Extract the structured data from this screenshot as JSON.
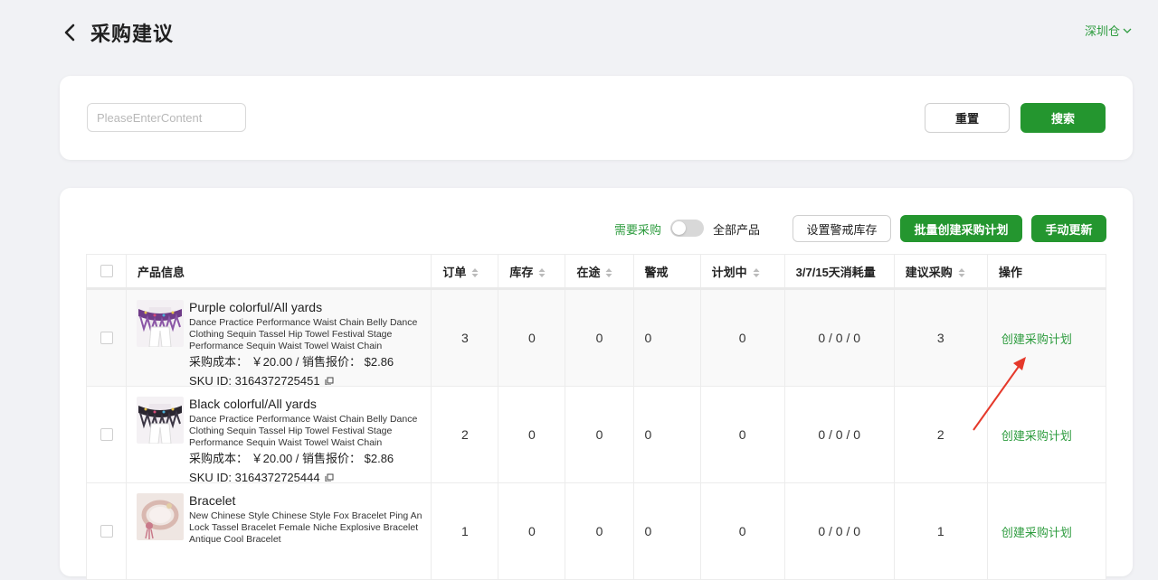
{
  "header": {
    "title": "采购建议",
    "warehouse": "深圳仓"
  },
  "search": {
    "placeholder": "PleaseEnterContent",
    "value": "",
    "reset_label": "重置",
    "search_label": "搜索"
  },
  "toolbar": {
    "need_purchase_label": "需要采购",
    "all_products_label": "全部产品",
    "toggle_on": false,
    "set_alert_label": "设置警戒库存",
    "batch_create_label": "批量创建采购计划",
    "manual_update_label": "手动更新"
  },
  "table": {
    "columns": [
      {
        "label": "产品信息",
        "sortable": false
      },
      {
        "label": "订单",
        "sortable": true
      },
      {
        "label": "库存",
        "sortable": true
      },
      {
        "label": "在途",
        "sortable": true
      },
      {
        "label": "警戒",
        "sortable": false
      },
      {
        "label": "计划中",
        "sortable": true
      },
      {
        "label": "3/7/15天消耗量",
        "sortable": false
      },
      {
        "label": "建议采购",
        "sortable": true
      },
      {
        "label": "操作",
        "sortable": false
      }
    ],
    "rows": [
      {
        "name": "Purple colorful/All yards",
        "desc": "Dance Practice Performance Waist Chain Belly Dance Clothing Sequin Tassel Hip Towel Festival Stage Performance Sequin Waist Towel Waist Chain",
        "cost": "采购成本： ￥20.00 / 销售报价： $2.86",
        "sku": "SKU ID: 3164372725451",
        "orders": "3",
        "stock": "0",
        "transit": "0",
        "alert": "0",
        "planned": "0",
        "consumption": "0 / 0 / 0",
        "suggested": "3",
        "action": "创建采购计划",
        "thumb": "belt-purple"
      },
      {
        "name": "Black colorful/All yards",
        "desc": "Dance Practice Performance Waist Chain Belly Dance Clothing Sequin Tassel Hip Towel Festival Stage Performance Sequin Waist Towel Waist Chain",
        "cost": "采购成本： ￥20.00 / 销售报价： $2.86",
        "sku": "SKU ID: 3164372725444",
        "orders": "2",
        "stock": "0",
        "transit": "0",
        "alert": "0",
        "planned": "0",
        "consumption": "0 / 0 / 0",
        "suggested": "2",
        "action": "创建采购计划",
        "thumb": "belt-black"
      },
      {
        "name": "Bracelet",
        "desc": "New Chinese Style Chinese Style Fox Bracelet Ping An Lock Tassel Bracelet Female Niche Explosive Bracelet Antique Cool Bracelet",
        "cost": "",
        "sku": "",
        "orders": "1",
        "stock": "0",
        "transit": "0",
        "alert": "0",
        "planned": "0",
        "consumption": "0 / 0 / 0",
        "suggested": "1",
        "action": "创建采购计划",
        "thumb": "bracelet"
      }
    ]
  },
  "colors": {
    "accent": "#24962f",
    "link": "#2e9c3f",
    "annotation": "#e5392b"
  }
}
